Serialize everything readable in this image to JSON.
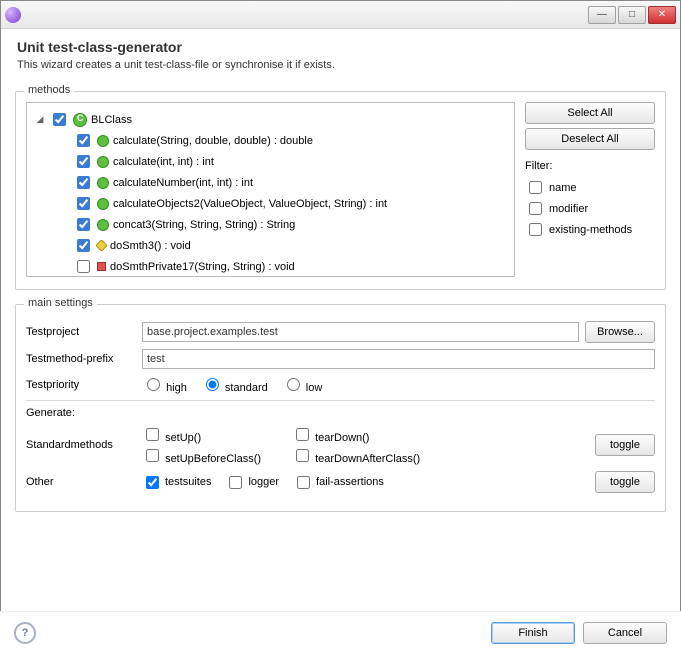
{
  "window": {
    "title": "Unit test-class-generator",
    "subtitle": "This wizard creates a unit test-class-file or synchronise it if exists."
  },
  "methods": {
    "legend": "methods",
    "class_name": "BLClass",
    "items": [
      {
        "label": "calculate(String, double, double) : double",
        "vis": "public",
        "checked": true
      },
      {
        "label": "calculate(int, int) : int",
        "vis": "public",
        "checked": true
      },
      {
        "label": "calculateNumber(int, int) : int",
        "vis": "public",
        "checked": true
      },
      {
        "label": "calculateObjects2(ValueObject, ValueObject, String) : int",
        "vis": "public",
        "checked": true
      },
      {
        "label": "concat3(String, String, String) : String",
        "vis": "public",
        "checked": true
      },
      {
        "label": "doSmth3() : void",
        "vis": "protected",
        "checked": true
      },
      {
        "label": "doSmthPrivate17(String, String) : void",
        "vis": "private",
        "checked": false
      }
    ],
    "select_all": "Select All",
    "deselect_all": "Deselect All",
    "filter_label": "Filter:",
    "filters": [
      {
        "label": "name",
        "checked": false
      },
      {
        "label": "modifier",
        "checked": false
      },
      {
        "label": "existing-methods",
        "checked": false
      }
    ]
  },
  "settings": {
    "legend": "main settings",
    "testproject_label": "Testproject",
    "testproject_value": "base.project.examples.test",
    "browse": "Browse...",
    "prefix_label": "Testmethod-prefix",
    "prefix_value": "test",
    "priority_label": "Testpriority",
    "priorities": {
      "high": "high",
      "standard": "standard",
      "low": "low",
      "selected": "standard"
    },
    "generate_label": "Generate:",
    "std_label": "Standardmethods",
    "std": {
      "setUp": "setUp()",
      "setUpBeforeClass": "setUpBeforeClass()",
      "tearDown": "tearDown()",
      "tearDownAfterClass": "tearDownAfterClass()"
    },
    "other_label": "Other",
    "other": [
      {
        "label": "testsuites",
        "checked": true
      },
      {
        "label": "logger",
        "checked": false
      },
      {
        "label": "fail-assertions",
        "checked": false
      }
    ],
    "toggle": "toggle"
  },
  "footer": {
    "finish": "Finish",
    "cancel": "Cancel"
  }
}
